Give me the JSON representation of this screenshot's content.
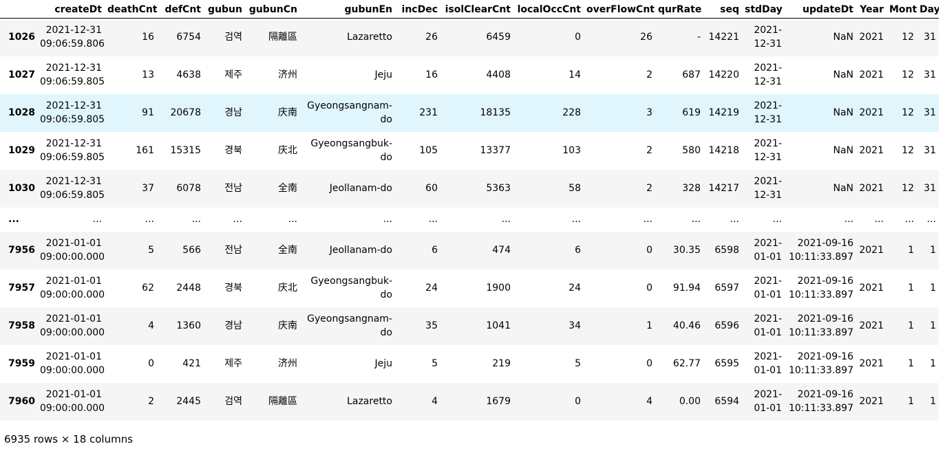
{
  "table": {
    "columns": [
      "createDt",
      "deathCnt",
      "defCnt",
      "gubun",
      "gubunCn",
      "gubunEn",
      "incDec",
      "isolClearCnt",
      "localOccCnt",
      "overFlowCnt",
      "qurRate",
      "seq",
      "stdDay",
      "updateDt",
      "Year",
      "Month",
      "Day"
    ],
    "rows": [
      {
        "index": "1026",
        "cells": [
          "2021-12-31 09:06:59.806",
          "16",
          "6754",
          "검역",
          "隔離區",
          "Lazaretto",
          "26",
          "6459",
          "0",
          "26",
          "-",
          "14221",
          "2021-12-31",
          "NaN",
          "2021",
          "12",
          "31"
        ]
      },
      {
        "index": "1027",
        "cells": [
          "2021-12-31 09:06:59.805",
          "13",
          "4638",
          "제주",
          "济州",
          "Jeju",
          "16",
          "4408",
          "14",
          "2",
          "687",
          "14220",
          "2021-12-31",
          "NaN",
          "2021",
          "12",
          "31"
        ]
      },
      {
        "index": "1028",
        "cells": [
          "2021-12-31 09:06:59.805",
          "91",
          "20678",
          "경남",
          "庆南",
          "Gyeongsangnam-do",
          "231",
          "18135",
          "228",
          "3",
          "619",
          "14219",
          "2021-12-31",
          "NaN",
          "2021",
          "12",
          "31"
        ]
      },
      {
        "index": "1029",
        "cells": [
          "2021-12-31 09:06:59.805",
          "161",
          "15315",
          "경북",
          "庆北",
          "Gyeongsangbuk-do",
          "105",
          "13377",
          "103",
          "2",
          "580",
          "14218",
          "2021-12-31",
          "NaN",
          "2021",
          "12",
          "31"
        ]
      },
      {
        "index": "1030",
        "cells": [
          "2021-12-31 09:06:59.805",
          "37",
          "6078",
          "전남",
          "全南",
          "Jeollanam-do",
          "60",
          "5363",
          "58",
          "2",
          "328",
          "14217",
          "2021-12-31",
          "NaN",
          "2021",
          "12",
          "31"
        ]
      },
      {
        "index": "...",
        "cells": [
          "...",
          "...",
          "...",
          "...",
          "...",
          "...",
          "...",
          "...",
          "...",
          "...",
          "...",
          "...",
          "...",
          "...",
          "...",
          "...",
          "..."
        ]
      },
      {
        "index": "7956",
        "cells": [
          "2021-01-01 09:00:00.000",
          "5",
          "566",
          "전남",
          "全南",
          "Jeollanam-do",
          "6",
          "474",
          "6",
          "0",
          "30.35",
          "6598",
          "2021-01-01",
          "2021-09-16 10:11:33.897",
          "2021",
          "1",
          "1"
        ]
      },
      {
        "index": "7957",
        "cells": [
          "2021-01-01 09:00:00.000",
          "62",
          "2448",
          "경북",
          "庆北",
          "Gyeongsangbuk-do",
          "24",
          "1900",
          "24",
          "0",
          "91.94",
          "6597",
          "2021-01-01",
          "2021-09-16 10:11:33.897",
          "2021",
          "1",
          "1"
        ]
      },
      {
        "index": "7958",
        "cells": [
          "2021-01-01 09:00:00.000",
          "4",
          "1360",
          "경남",
          "庆南",
          "Gyeongsangnam-do",
          "35",
          "1041",
          "34",
          "1",
          "40.46",
          "6596",
          "2021-01-01",
          "2021-09-16 10:11:33.897",
          "2021",
          "1",
          "1"
        ]
      },
      {
        "index": "7959",
        "cells": [
          "2021-01-01 09:00:00.000",
          "0",
          "421",
          "제주",
          "济州",
          "Jeju",
          "5",
          "219",
          "5",
          "0",
          "62.77",
          "6595",
          "2021-01-01",
          "2021-09-16 10:11:33.897",
          "2021",
          "1",
          "1"
        ]
      },
      {
        "index": "7960",
        "cells": [
          "2021-01-01 09:00:00.000",
          "2",
          "2445",
          "검역",
          "隔離區",
          "Lazaretto",
          "4",
          "1679",
          "0",
          "4",
          "0.00",
          "6594",
          "2021-01-01",
          "2021-09-16 10:11:33.897",
          "2021",
          "1",
          "1"
        ]
      }
    ],
    "hovered_row_index": "1028"
  },
  "footer": {
    "shape_text": "6935 rows × 18 columns"
  },
  "colors": {
    "header_border": "#000000",
    "odd_row": "#f5f5f5",
    "even_row": "#ffffff",
    "hover_row": "#e1f5fc"
  }
}
